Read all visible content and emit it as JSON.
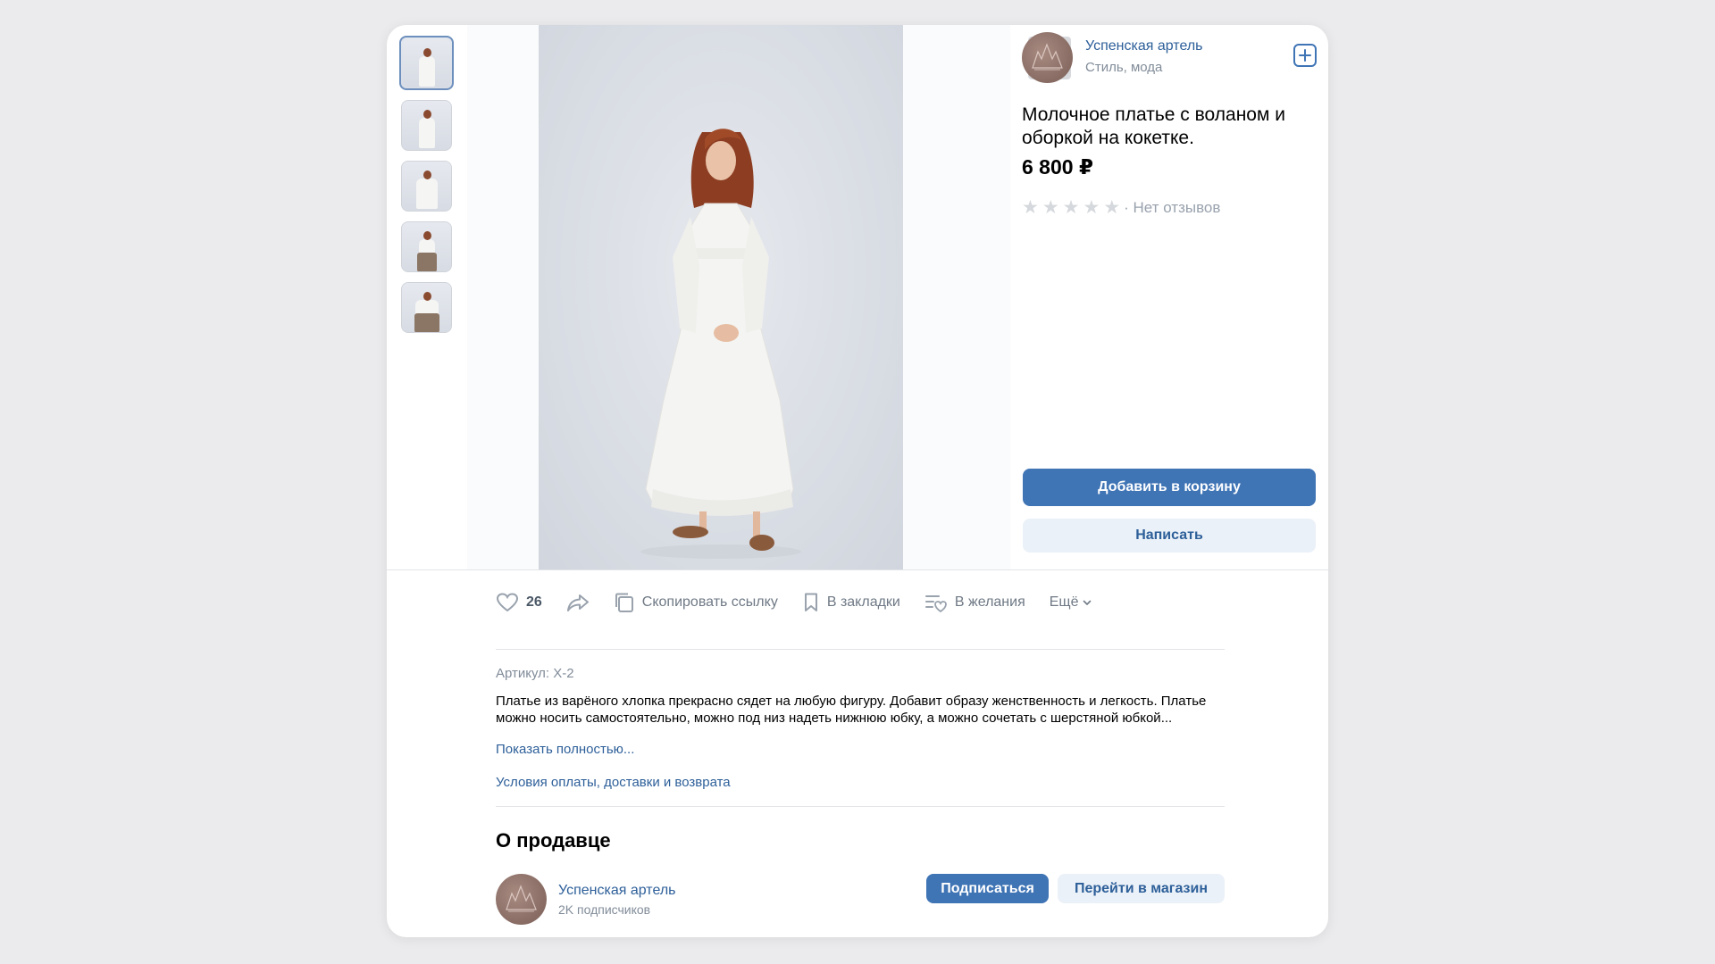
{
  "product": {
    "title": "Молочное платье с воланом и оборкой на кокетке.",
    "price": "6 800 ₽",
    "rating_stars": 5,
    "reviews_text": "· Нет отзывов"
  },
  "shop": {
    "name": "Успенская артель",
    "category": "Стиль, мода"
  },
  "buttons": {
    "add_to_cart": "Добавить в корзину",
    "write": "Написать",
    "subscribe": "Подписаться",
    "go_to_shop": "Перейти в магазин"
  },
  "actions": {
    "likes": "26",
    "copy_link": "Скопировать ссылку",
    "bookmarks": "В закладки",
    "wishlist": "В желания",
    "more": "Ещё"
  },
  "details": {
    "article": "Артикул: X-2",
    "description": "Платье из варёного хлопка прекрасно сядет на любую фигуру. Добавит образу женственность и легкость. Платье можно носить самостоятельно, можно под низ надеть нижнюю юбку, а можно сочетать с шерстяной юбкой...",
    "show_more": "Показать полностью...",
    "terms": "Условия оплаты, доставки и возврата"
  },
  "seller": {
    "heading": "О продавце",
    "name": "Успенская артель",
    "subscribers": "2K подписчиков"
  },
  "colors": {
    "accent": "#3f74b5",
    "link": "#2d5f99",
    "secondary_bg": "#ebf1f8",
    "muted": "#818c99"
  },
  "icons": [
    "zoom-in-icon",
    "add-square-icon",
    "heart-icon",
    "share-icon",
    "copy-icon",
    "bookmark-icon",
    "wishlist-icon",
    "chevron-down-icon",
    "star-icon"
  ]
}
